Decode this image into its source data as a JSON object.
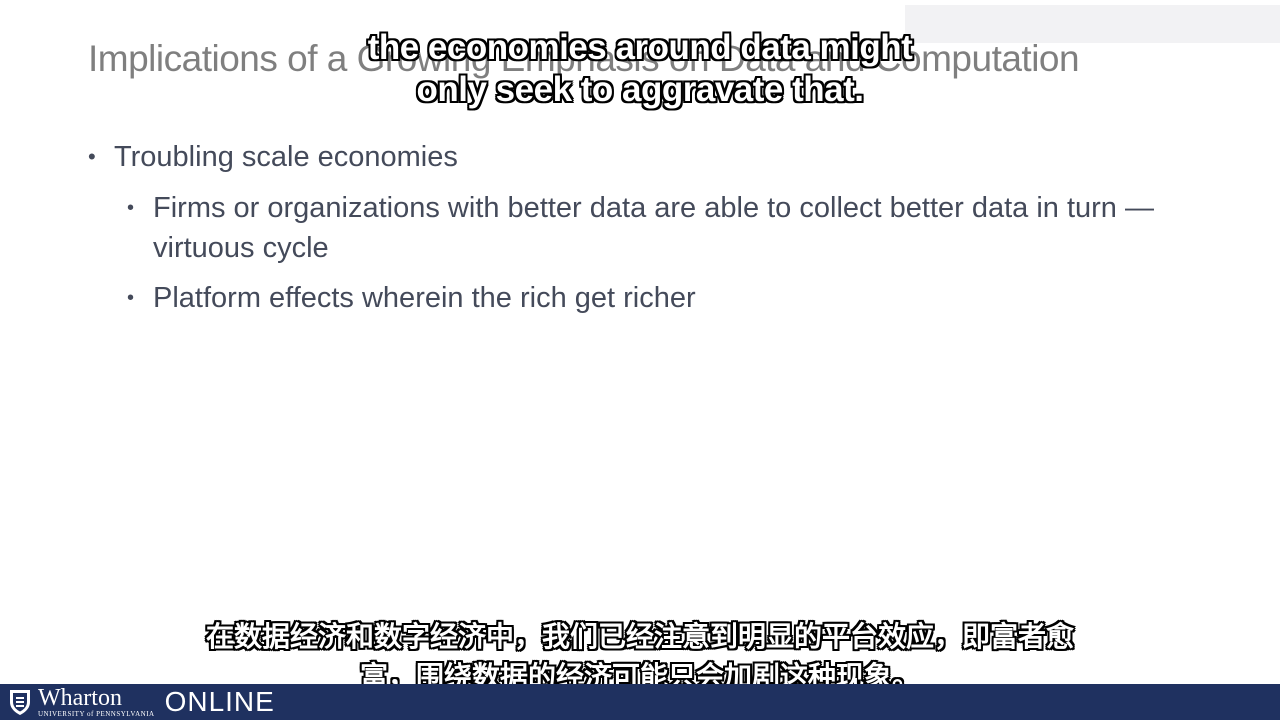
{
  "slide": {
    "title": "Implications of a Growing Emphasis on Data and Computation",
    "bullets": [
      {
        "text": "Troubling scale economies",
        "children": [
          "Firms or organizations with better data are able to collect better data in turn — virtuous cycle",
          "Platform effects wherein the rich get richer"
        ]
      }
    ]
  },
  "subtitles": {
    "english": [
      "the economies around data might",
      "only seek to aggravate that."
    ],
    "chinese": [
      "在数据经济和数字经济中，我们已经注意到明显的平台效应，即富者愈",
      "富，围绕数据的经济可能只会加剧这种现象。"
    ]
  },
  "footer": {
    "logo_word": "Wharton",
    "logo_university": "UNIVERSITY of PENNSYLVANIA",
    "logo_online": "ONLINE",
    "background_color": "#1f3160"
  }
}
